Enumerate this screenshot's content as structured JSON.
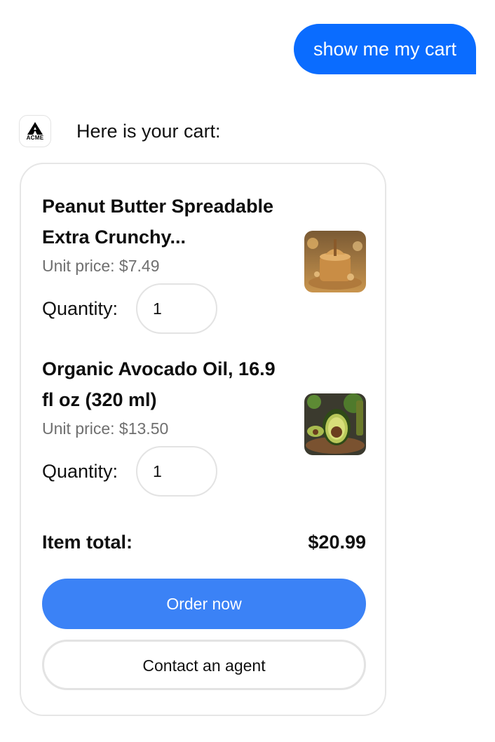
{
  "chat": {
    "user_message": "show me my cart",
    "assistant_message": "Here is your cart:",
    "avatar_text": "ACME"
  },
  "cart": {
    "items": [
      {
        "name": "Peanut Butter Spreadable Extra Crunchy...",
        "unit_price": "Unit price: $7.49",
        "quantity_label": "Quantity:",
        "quantity": "1",
        "image": "peanut-butter-image"
      },
      {
        "name": "Organic Avocado Oil, 16.9 fl oz (320 ml)",
        "unit_price": "Unit price: $13.50",
        "quantity_label": "Quantity:",
        "quantity": "1",
        "image": "avocado-oil-image"
      }
    ],
    "total_label": "Item total:",
    "total_value": "$20.99",
    "order_button": "Order now",
    "contact_button": "Contact an agent"
  },
  "colors": {
    "user_bubble": "#0a6cff",
    "primary_button": "#3b82f6",
    "card_border": "#e6e6e6",
    "muted_text": "#6f6f6f"
  }
}
